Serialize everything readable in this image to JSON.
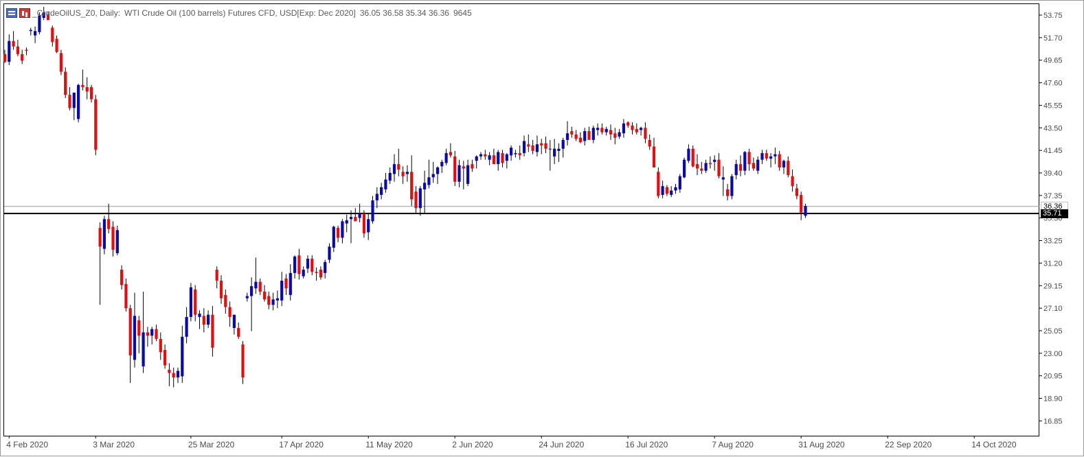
{
  "header": {
    "symbol": "_CrudeOilUS_Z0, Daily:",
    "description": "WTI Crude Oil (100 barrels) Futures CFD, USD[Exp: Dec 2020]",
    "ohlc": "36.05 36.58 35.34 36.36",
    "volume": "9645"
  },
  "price_tags": {
    "current": "36.36",
    "level": "35.71"
  },
  "colors": {
    "bull": "#0a0aa8",
    "bear": "#e01010",
    "wick": "#000000",
    "axis_text": "#4a4a4a"
  },
  "chart_data": {
    "type": "candlestick",
    "y_range": [
      15.5,
      54.75
    ],
    "y_ticks": [
      "53.75",
      "51.70",
      "49.65",
      "47.60",
      "45.55",
      "43.50",
      "41.45",
      "39.40",
      "37.35",
      "36.36",
      "35.30",
      "33.25",
      "31.20",
      "29.15",
      "27.10",
      "25.05",
      "23.00",
      "20.95",
      "18.90",
      "16.85"
    ],
    "x_labels": [
      {
        "label": "4 Feb 2020",
        "bar": 1
      },
      {
        "label": "3 Mar 2020",
        "bar": 21
      },
      {
        "label": "25 Mar 2020",
        "bar": 43
      },
      {
        "label": "17 Apr 2020",
        "bar": 64
      },
      {
        "label": "11 May 2020",
        "bar": 84
      },
      {
        "label": "2 Jun 2020",
        "bar": 104
      },
      {
        "label": "24 Jun 2020",
        "bar": 124
      },
      {
        "label": "16 Jul 2020",
        "bar": 144
      },
      {
        "label": "7 Aug 2020",
        "bar": 164
      },
      {
        "label": "31 Aug 2020",
        "bar": 184
      },
      {
        "label": "22 Sep 2020",
        "bar": 204
      },
      {
        "label": "14 Oct 2020",
        "bar": 224
      }
    ],
    "horizontal_lines": [
      {
        "value": 36.36
      },
      {
        "value": 35.71
      }
    ],
    "candles": [
      [
        50.2,
        50.6,
        49.4,
        49.5
      ],
      [
        49.5,
        52.0,
        49.2,
        51.4
      ],
      [
        51.4,
        52.3,
        50.6,
        50.9
      ],
      [
        50.9,
        51.5,
        50.0,
        50.2
      ],
      [
        50.2,
        50.6,
        49.3,
        49.6
      ],
      [
        50.6,
        50.8,
        50.1,
        50.5
      ],
      [
        52.3,
        52.6,
        51.9,
        52.4
      ],
      [
        51.9,
        52.7,
        51.2,
        52.3
      ],
      [
        52.2,
        54.0,
        52.0,
        53.7
      ],
      [
        53.5,
        54.5,
        53.3,
        54.0
      ],
      [
        53.8,
        54.1,
        53.3,
        53.3
      ],
      [
        52.6,
        52.8,
        50.9,
        51.3
      ],
      [
        51.6,
        51.9,
        50.3,
        50.4
      ],
      [
        50.3,
        50.6,
        48.3,
        48.6
      ],
      [
        48.6,
        49.0,
        46.2,
        46.5
      ],
      [
        46.5,
        47.2,
        45.1,
        45.3
      ],
      [
        45.3,
        45.6,
        44.2,
        46.7
      ],
      [
        44.3,
        47.5,
        44.0,
        47.4
      ],
      [
        47.4,
        48.8,
        46.9,
        47.2
      ],
      [
        47.2,
        48.1,
        46.1,
        46.8
      ],
      [
        47.2,
        47.4,
        45.8,
        46.1
      ],
      [
        46.1,
        46.5,
        41.0,
        41.5
      ],
      [
        34.4,
        34.9,
        27.4,
        32.7
      ],
      [
        32.5,
        35.5,
        32.0,
        35.2
      ],
      [
        35.2,
        36.6,
        33.9,
        34.3
      ],
      [
        34.5,
        35.0,
        31.8,
        32.4
      ],
      [
        32.1,
        34.6,
        31.9,
        34.2
      ],
      [
        30.6,
        31.0,
        28.8,
        29.2
      ],
      [
        29.3,
        29.8,
        26.8,
        27.1
      ],
      [
        27.1,
        27.4,
        20.3,
        22.8
      ],
      [
        22.4,
        28.5,
        21.7,
        26.4
      ],
      [
        26.0,
        26.4,
        23.0,
        24.6
      ],
      [
        21.8,
        28.6,
        21.2,
        24.9
      ],
      [
        24.9,
        25.4,
        23.6,
        24.6
      ],
      [
        24.6,
        25.4,
        23.8,
        25.2
      ],
      [
        25.2,
        25.6,
        24.1,
        24.3
      ],
      [
        24.3,
        24.9,
        22.4,
        23.1
      ],
      [
        23.3,
        23.8,
        21.6,
        21.9
      ],
      [
        21.5,
        22.1,
        20.0,
        21.2
      ],
      [
        21.2,
        21.7,
        19.9,
        20.8
      ],
      [
        20.8,
        21.7,
        20.3,
        21.4
      ],
      [
        20.9,
        25.5,
        20.3,
        24.5
      ],
      [
        24.5,
        27.2,
        23.9,
        26.3
      ],
      [
        26.3,
        29.4,
        25.9,
        29.0
      ],
      [
        28.8,
        29.2,
        25.9,
        26.5
      ],
      [
        26.3,
        26.9,
        25.2,
        26.6
      ],
      [
        26.4,
        27.1,
        24.9,
        25.6
      ],
      [
        25.6,
        26.9,
        25.3,
        26.5
      ],
      [
        26.5,
        27.3,
        22.7,
        23.5
      ],
      [
        30.6,
        30.9,
        28.9,
        29.6
      ],
      [
        29.6,
        30.1,
        27.5,
        28.0
      ],
      [
        28.3,
        28.8,
        26.6,
        27.2
      ],
      [
        27.2,
        27.7,
        25.4,
        26.3
      ],
      [
        25.3,
        26.5,
        24.7,
        26.5
      ],
      [
        25.3,
        25.8,
        24.3,
        24.5
      ],
      [
        23.8,
        24.1,
        20.2,
        20.8
      ],
      [
        28.0,
        28.5,
        27.7,
        28.2
      ],
      [
        28.2,
        29.9,
        25.0,
        29.1
      ],
      [
        28.9,
        31.7,
        28.4,
        29.5
      ],
      [
        29.5,
        29.8,
        28.3,
        28.6
      ],
      [
        28.6,
        29.2,
        27.7,
        27.9
      ],
      [
        28.2,
        28.6,
        27.0,
        27.4
      ],
      [
        27.4,
        28.5,
        26.9,
        27.9
      ],
      [
        27.8,
        28.7,
        27.1,
        28.0
      ],
      [
        27.8,
        30.4,
        27.3,
        29.6
      ],
      [
        29.8,
        30.2,
        28.3,
        28.9
      ],
      [
        28.3,
        31.1,
        27.8,
        30.3
      ],
      [
        30.3,
        31.9,
        29.8,
        31.8
      ],
      [
        31.9,
        32.5,
        29.7,
        30.2
      ],
      [
        30.0,
        30.9,
        29.8,
        30.6
      ],
      [
        30.7,
        31.9,
        30.3,
        31.6
      ],
      [
        31.6,
        31.9,
        30.1,
        30.4
      ],
      [
        30.4,
        30.8,
        29.6,
        30.3
      ],
      [
        30.6,
        30.9,
        29.7,
        29.9
      ],
      [
        30.3,
        31.5,
        29.8,
        31.3
      ],
      [
        31.5,
        33.0,
        31.2,
        32.7
      ],
      [
        32.6,
        34.6,
        32.2,
        34.5
      ],
      [
        34.4,
        34.6,
        33.1,
        33.5
      ],
      [
        33.5,
        35.2,
        33.0,
        35.0
      ],
      [
        34.8,
        35.6,
        34.0,
        35.1
      ],
      [
        35.2,
        36.0,
        33.0,
        35.4
      ],
      [
        35.4,
        36.2,
        35.0,
        35.0
      ],
      [
        35.3,
        36.6,
        34.9,
        35.7
      ],
      [
        35.7,
        36.0,
        33.5,
        33.9
      ],
      [
        34.0,
        35.7,
        33.3,
        35.2
      ],
      [
        35.0,
        37.3,
        34.8,
        36.9
      ],
      [
        36.9,
        38.1,
        36.2,
        37.5
      ],
      [
        37.4,
        38.5,
        37.0,
        38.1
      ],
      [
        37.9,
        39.4,
        37.6,
        38.8
      ],
      [
        38.7,
        39.9,
        38.4,
        39.4
      ],
      [
        39.3,
        41.1,
        38.6,
        40.2
      ],
      [
        40.2,
        41.6,
        39.1,
        39.7
      ],
      [
        39.5,
        40.0,
        38.4,
        39.1
      ],
      [
        39.3,
        40.1,
        38.6,
        39.5
      ],
      [
        39.5,
        41.0,
        36.4,
        37.0
      ],
      [
        37.7,
        38.2,
        35.7,
        36.2
      ],
      [
        36.2,
        38.2,
        35.5,
        38.0
      ],
      [
        37.9,
        39.6,
        35.7,
        38.5
      ],
      [
        38.3,
        40.6,
        38.0,
        39.0
      ],
      [
        39.0,
        40.4,
        38.5,
        39.3
      ],
      [
        39.3,
        40.0,
        38.4,
        39.9
      ],
      [
        40.0,
        40.6,
        39.4,
        40.4
      ],
      [
        40.3,
        41.6,
        40.1,
        41.2
      ],
      [
        41.3,
        42.1,
        40.8,
        41.0
      ],
      [
        40.9,
        41.4,
        38.2,
        38.6
      ],
      [
        38.6,
        40.6,
        38.1,
        40.1
      ],
      [
        40.0,
        40.5,
        37.9,
        39.8
      ],
      [
        38.4,
        40.6,
        38.2,
        40.1
      ],
      [
        40.2,
        40.6,
        39.5,
        39.8
      ],
      [
        40.5,
        41.0,
        39.8,
        40.9
      ],
      [
        40.9,
        41.3,
        40.6,
        41.1
      ],
      [
        41.1,
        41.5,
        40.6,
        40.9
      ],
      [
        40.6,
        41.3,
        40.1,
        41.0
      ],
      [
        41.0,
        41.6,
        40.4,
        40.2
      ],
      [
        40.2,
        41.5,
        39.6,
        41.3
      ],
      [
        41.2,
        41.5,
        39.9,
        40.3
      ],
      [
        40.5,
        41.2,
        39.8,
        41.1
      ],
      [
        41.0,
        41.9,
        40.5,
        41.7
      ],
      [
        41.1,
        41.5,
        40.8,
        41.2
      ],
      [
        41.2,
        41.9,
        40.6,
        41.0
      ],
      [
        41.2,
        42.8,
        40.9,
        42.3
      ],
      [
        42.0,
        42.9,
        41.3,
        41.8
      ],
      [
        41.9,
        42.4,
        41.1,
        41.4
      ],
      [
        41.3,
        42.8,
        40.9,
        42.0
      ],
      [
        42.1,
        42.5,
        41.1,
        41.9
      ],
      [
        42.1,
        42.7,
        41.2,
        41.6
      ],
      [
        41.6,
        42.4,
        39.6,
        41.6
      ],
      [
        40.9,
        42.5,
        40.2,
        41.6
      ],
      [
        41.4,
        42.1,
        40.4,
        41.6
      ],
      [
        41.6,
        42.6,
        40.8,
        42.4
      ],
      [
        42.4,
        44.1,
        41.9,
        43.0
      ],
      [
        43.2,
        43.6,
        42.6,
        42.9
      ],
      [
        42.9,
        43.3,
        42.3,
        42.5
      ],
      [
        42.6,
        43.1,
        42.1,
        42.2
      ],
      [
        42.3,
        43.5,
        41.9,
        43.2
      ],
      [
        43.2,
        43.6,
        42.9,
        42.4
      ],
      [
        42.4,
        43.7,
        42.1,
        43.5
      ],
      [
        43.3,
        43.9,
        42.8,
        43.5
      ],
      [
        43.5,
        43.9,
        42.9,
        43.1
      ],
      [
        43.1,
        43.6,
        42.8,
        43.4
      ],
      [
        43.3,
        43.8,
        42.4,
        42.9
      ],
      [
        43.0,
        43.5,
        42.0,
        42.6
      ],
      [
        42.7,
        43.4,
        42.5,
        43.1
      ],
      [
        43.0,
        44.3,
        42.6,
        43.9
      ],
      [
        44.0,
        44.1,
        43.5,
        43.7
      ],
      [
        43.7,
        44.0,
        42.9,
        43.3
      ],
      [
        43.4,
        43.9,
        42.9,
        43.1
      ],
      [
        43.3,
        43.6,
        42.8,
        43.5
      ],
      [
        43.5,
        44.0,
        42.1,
        42.5
      ],
      [
        42.4,
        42.9,
        41.5,
        41.8
      ],
      [
        41.8,
        42.6,
        39.9,
        39.9
      ],
      [
        39.5,
        39.9,
        37.1,
        37.3
      ],
      [
        37.4,
        38.7,
        37.1,
        38.2
      ],
      [
        38.1,
        38.3,
        37.3,
        37.5
      ],
      [
        37.4,
        38.2,
        37.2,
        37.8
      ],
      [
        37.8,
        38.4,
        37.5,
        38.1
      ],
      [
        37.9,
        39.3,
        37.6,
        39.1
      ],
      [
        39.0,
        40.8,
        38.9,
        40.6
      ],
      [
        40.5,
        42.0,
        40.3,
        41.6
      ],
      [
        41.6,
        41.9,
        39.9,
        40.0
      ],
      [
        40.2,
        41.1,
        39.2,
        39.8
      ],
      [
        39.8,
        40.4,
        39.3,
        39.6
      ],
      [
        39.6,
        40.6,
        39.4,
        40.3
      ],
      [
        40.3,
        40.9,
        39.8,
        40.2
      ],
      [
        40.4,
        41.0,
        39.6,
        40.6
      ],
      [
        40.6,
        41.2,
        38.9,
        39.1
      ],
      [
        38.8,
        40.0,
        37.3,
        39.0
      ],
      [
        37.9,
        38.4,
        36.9,
        37.3
      ],
      [
        37.3,
        39.3,
        37.0,
        39.1
      ],
      [
        39.2,
        40.6,
        38.8,
        40.2
      ],
      [
        40.2,
        41.0,
        39.1,
        39.6
      ],
      [
        39.6,
        41.4,
        39.2,
        41.3
      ],
      [
        41.3,
        41.6,
        39.6,
        40.2
      ],
      [
        40.3,
        40.8,
        39.6,
        39.8
      ],
      [
        39.6,
        40.9,
        39.3,
        40.6
      ],
      [
        40.6,
        41.5,
        40.2,
        41.2
      ],
      [
        41.2,
        41.5,
        40.5,
        40.7
      ],
      [
        40.7,
        41.2,
        39.9,
        40.9
      ],
      [
        40.9,
        41.7,
        40.2,
        41.1
      ],
      [
        41.1,
        41.4,
        39.6,
        39.9
      ],
      [
        39.9,
        40.6,
        39.3,
        40.5
      ],
      [
        40.5,
        40.9,
        39.0,
        39.2
      ],
      [
        39.1,
        39.7,
        37.7,
        38.2
      ],
      [
        38.0,
        38.4,
        37.0,
        37.3
      ],
      [
        37.4,
        37.7,
        35.1,
        35.8
      ],
      [
        35.5,
        36.6,
        35.3,
        36.4
      ]
    ]
  }
}
